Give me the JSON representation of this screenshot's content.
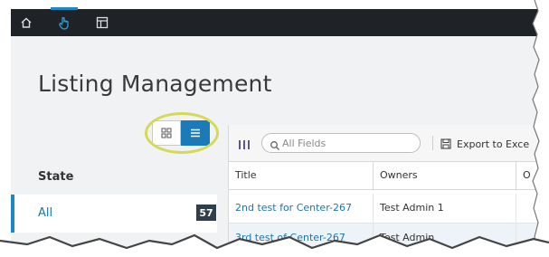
{
  "nav": {
    "items": [
      {
        "icon": "home-icon",
        "active": false
      },
      {
        "icon": "hand-pointer-icon",
        "active": true
      },
      {
        "icon": "layout-panel-icon",
        "active": false
      }
    ],
    "accent": "#1a8ac4"
  },
  "page": {
    "title": "Listing Management"
  },
  "view_toggle": {
    "selected": "list"
  },
  "state": {
    "heading": "State",
    "items": [
      {
        "label": "All",
        "count": "57"
      }
    ]
  },
  "toolbar": {
    "search_placeholder": "All Fields",
    "export_label": "Export to Exce"
  },
  "table": {
    "columns": [
      "Title",
      "Owners",
      "O"
    ],
    "rows": [
      {
        "title": "2nd test for Center-267",
        "owners": "Test Admin 1"
      },
      {
        "title": "3rd test of Center-267",
        "owners": "Test Admin"
      }
    ]
  },
  "colors": {
    "topnav_bg": "#1f2328",
    "accent_blue": "#1b7bb8",
    "highlight": "#d5d955",
    "badge_bg": "#2f3e4a"
  }
}
